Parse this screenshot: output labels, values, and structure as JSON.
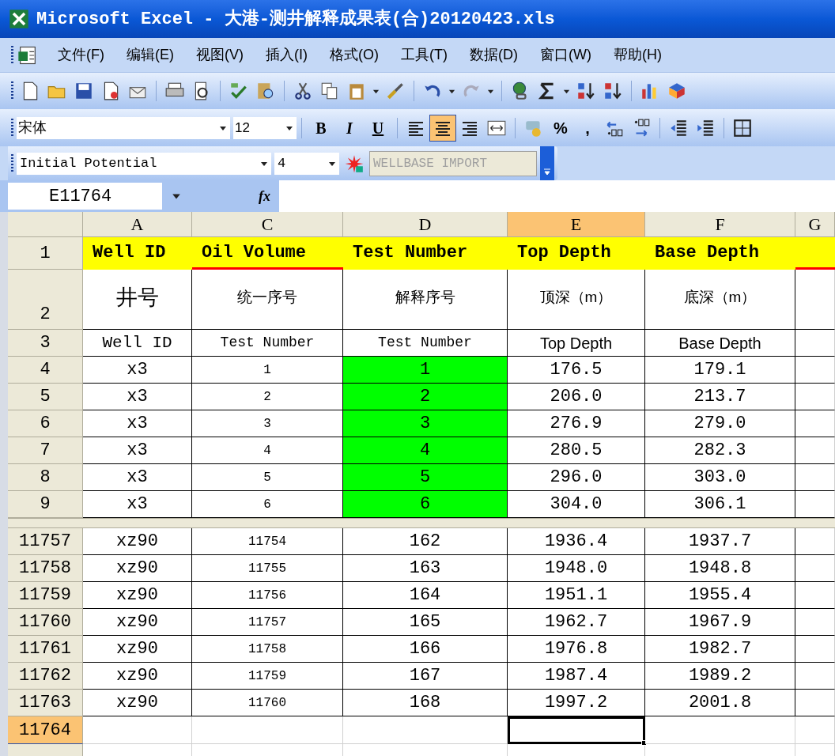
{
  "window": {
    "title": "Microsoft Excel - 大港-测井解释成果表(合)20120423.xls"
  },
  "menu": [
    "文件(F)",
    "编辑(E)",
    "视图(V)",
    "插入(I)",
    "格式(O)",
    "工具(T)",
    "数据(D)",
    "窗口(W)",
    "帮助(H)"
  ],
  "formatting_toolbar": {
    "font": "宋体",
    "size": "12",
    "style_buttons": [
      "B",
      "I",
      "U"
    ],
    "alignment_buttons": [
      {
        "selected": false
      },
      {
        "selected": true
      },
      {
        "selected": false
      }
    ],
    "number_buttons": [
      "%",
      ","
    ]
  },
  "custom_toolbar": {
    "field": "Initial Potential",
    "value": "4",
    "import_button": {
      "label": "WELLBASE IMPORT",
      "disabled": true
    }
  },
  "formula_bar": {
    "name_box": "E11764",
    "function_label": "fx"
  },
  "sheet": {
    "columns": [
      {
        "label": "A",
        "selected": false
      },
      {
        "label": "C",
        "selected": false
      },
      {
        "label": "D",
        "selected": false
      },
      {
        "label": "E",
        "selected": true
      },
      {
        "label": "F",
        "selected": false
      },
      {
        "label": "G",
        "selected": false
      }
    ],
    "row_groups": [
      {
        "rows": [
          {
            "kind": "title",
            "number": "1",
            "selected": false,
            "cells": [
              {
                "text": "Well ID",
                "underlined": false
              },
              {
                "text": "Oil Volume",
                "underlined": true
              },
              {
                "text": "Test Number",
                "underlined": false
              },
              {
                "text": "Top Depth",
                "underlined": false
              },
              {
                "text": "Base Depth",
                "underlined": false
              },
              {
                "underlined": true
              }
            ]
          },
          {
            "kind": "chinese",
            "number": "2",
            "selected": false,
            "cells": [
              {
                "text": "井号"
              },
              {
                "text": "统一序号"
              },
              {
                "text": "解释序号"
              },
              {
                "text": "顶深（m）"
              },
              {
                "text": "底深（m）"
              }
            ]
          },
          {
            "kind": "english",
            "number": "3",
            "selected": false,
            "cells": [
              {
                "text": "Well ID"
              },
              {
                "text": "Test Number"
              },
              {
                "text": "Test Number"
              },
              {
                "text": "Top Depth"
              },
              {
                "text": "Base Depth"
              }
            ]
          },
          {
            "kind": "data",
            "number": "4",
            "selected": false,
            "cells": [
              {
                "text": "x3",
                "highlighted": false
              },
              {
                "text": "1",
                "highlighted": false
              },
              {
                "text": "1",
                "highlighted": true
              },
              {
                "text": "176.5",
                "highlighted": false
              },
              {
                "text": "179.1",
                "highlighted": false
              }
            ]
          },
          {
            "kind": "data",
            "number": "5",
            "selected": false,
            "cells": [
              {
                "text": "x3",
                "highlighted": false
              },
              {
                "text": "2",
                "highlighted": false
              },
              {
                "text": "2",
                "highlighted": true
              },
              {
                "text": "206.0",
                "highlighted": false
              },
              {
                "text": "213.7",
                "highlighted": false
              }
            ]
          },
          {
            "kind": "data",
            "number": "6",
            "selected": false,
            "cells": [
              {
                "text": "x3",
                "highlighted": false
              },
              {
                "text": "3",
                "highlighted": false
              },
              {
                "text": "3",
                "highlighted": true
              },
              {
                "text": "276.9",
                "highlighted": false
              },
              {
                "text": "279.0",
                "highlighted": false
              }
            ]
          },
          {
            "kind": "data",
            "number": "7",
            "selected": false,
            "cells": [
              {
                "text": "x3",
                "highlighted": false
              },
              {
                "text": "4",
                "highlighted": false
              },
              {
                "text": "4",
                "highlighted": true
              },
              {
                "text": "280.5",
                "highlighted": false
              },
              {
                "text": "282.3",
                "highlighted": false
              }
            ]
          },
          {
            "kind": "data",
            "number": "8",
            "selected": false,
            "cells": [
              {
                "text": "x3",
                "highlighted": false
              },
              {
                "text": "5",
                "highlighted": false
              },
              {
                "text": "5",
                "highlighted": true
              },
              {
                "text": "296.0",
                "highlighted": false
              },
              {
                "text": "303.0",
                "highlighted": false
              }
            ]
          },
          {
            "kind": "data",
            "number": "9",
            "selected": false,
            "cells": [
              {
                "text": "x3",
                "highlighted": false
              },
              {
                "text": "6",
                "highlighted": false
              },
              {
                "text": "6",
                "highlighted": true
              },
              {
                "text": "304.0",
                "highlighted": false
              },
              {
                "text": "306.1",
                "highlighted": false
              }
            ]
          }
        ]
      },
      {
        "rows": [
          {
            "kind": "data",
            "number": "11757",
            "selected": false,
            "cells": [
              {
                "text": "xz90",
                "highlighted": false
              },
              {
                "text": "11754",
                "highlighted": false
              },
              {
                "text": "162",
                "highlighted": false
              },
              {
                "text": "1936.4",
                "highlighted": false
              },
              {
                "text": "1937.7",
                "highlighted": false
              }
            ]
          },
          {
            "kind": "data",
            "number": "11758",
            "selected": false,
            "cells": [
              {
                "text": "xz90",
                "highlighted": false
              },
              {
                "text": "11755",
                "highlighted": false
              },
              {
                "text": "163",
                "highlighted": false
              },
              {
                "text": "1948.0",
                "highlighted": false
              },
              {
                "text": "1948.8",
                "highlighted": false
              }
            ]
          },
          {
            "kind": "data",
            "number": "11759",
            "selected": false,
            "cells": [
              {
                "text": "xz90",
                "highlighted": false
              },
              {
                "text": "11756",
                "highlighted": false
              },
              {
                "text": "164",
                "highlighted": false
              },
              {
                "text": "1951.1",
                "highlighted": false
              },
              {
                "text": "1955.4",
                "highlighted": false
              }
            ]
          },
          {
            "kind": "data",
            "number": "11760",
            "selected": false,
            "cells": [
              {
                "text": "xz90",
                "highlighted": false
              },
              {
                "text": "11757",
                "highlighted": false
              },
              {
                "text": "165",
                "highlighted": false
              },
              {
                "text": "1962.7",
                "highlighted": false
              },
              {
                "text": "1967.9",
                "highlighted": false
              }
            ]
          },
          {
            "kind": "data",
            "number": "11761",
            "selected": false,
            "cells": [
              {
                "text": "xz90",
                "highlighted": false
              },
              {
                "text": "11758",
                "highlighted": false
              },
              {
                "text": "166",
                "highlighted": false
              },
              {
                "text": "1976.8",
                "highlighted": false
              },
              {
                "text": "1982.7",
                "highlighted": false
              }
            ]
          },
          {
            "kind": "data",
            "number": "11762",
            "selected": false,
            "cells": [
              {
                "text": "xz90",
                "highlighted": false
              },
              {
                "text": "11759",
                "highlighted": false
              },
              {
                "text": "167",
                "highlighted": false
              },
              {
                "text": "1987.4",
                "highlighted": false
              },
              {
                "text": "1989.2",
                "highlighted": false
              }
            ]
          },
          {
            "kind": "data",
            "number": "11763",
            "selected": false,
            "cells": [
              {
                "text": "xz90",
                "highlighted": false
              },
              {
                "text": "11760",
                "highlighted": false
              },
              {
                "text": "168",
                "highlighted": false
              },
              {
                "text": "1997.2",
                "highlighted": false
              },
              {
                "text": "2001.8",
                "highlighted": false
              }
            ]
          },
          {
            "kind": "blank",
            "number": "11764",
            "selected": true,
            "cells": [
              {
                "active": false
              },
              {
                "active": false
              },
              {
                "active": false
              },
              {
                "active": true
              },
              {
                "active": false
              }
            ]
          }
        ]
      }
    ]
  }
}
